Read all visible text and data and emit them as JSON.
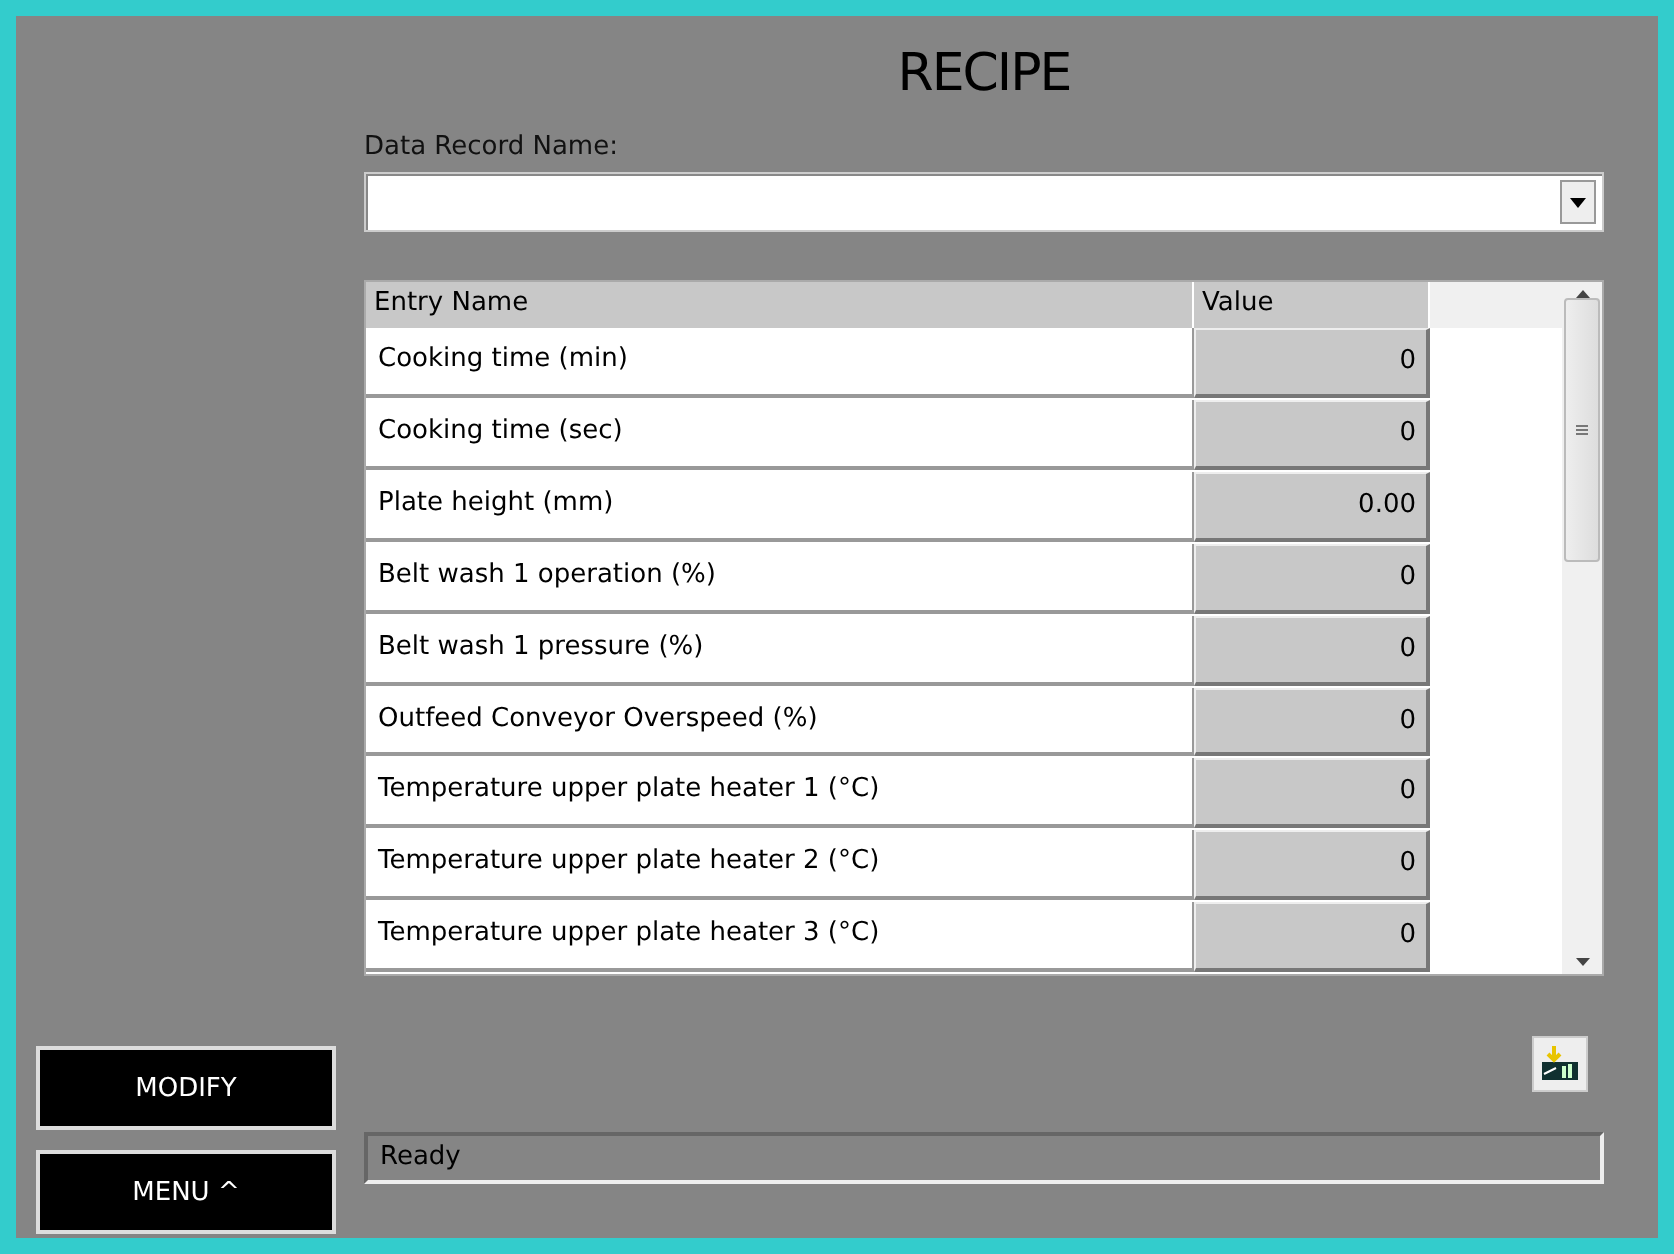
{
  "title": "RECIPE",
  "record": {
    "label": "Data Record Name:"
  },
  "table": {
    "columns": [
      "Entry Name",
      "Value"
    ],
    "rows": [
      {
        "name": "Cooking time (min)",
        "value": "0"
      },
      {
        "name": "Cooking time (sec)",
        "value": "0"
      },
      {
        "name": "Plate height (mm)",
        "value": "0.00"
      },
      {
        "name": "Belt wash 1 operation (%)",
        "value": "0"
      },
      {
        "name": "Belt wash 1 pressure (%)",
        "value": "0"
      },
      {
        "name": "Outfeed Conveyor Overspeed (%)",
        "value": "0"
      },
      {
        "name": "Temperature upper plate heater 1 (°C)",
        "value": "0"
      },
      {
        "name": "Temperature upper plate heater 2 (°C)",
        "value": "0"
      },
      {
        "name": "Temperature upper plate heater 3 (°C)",
        "value": "0"
      }
    ]
  },
  "buttons": [
    "MODIFY",
    "MENU ^"
  ],
  "status_bar": "Ready"
}
